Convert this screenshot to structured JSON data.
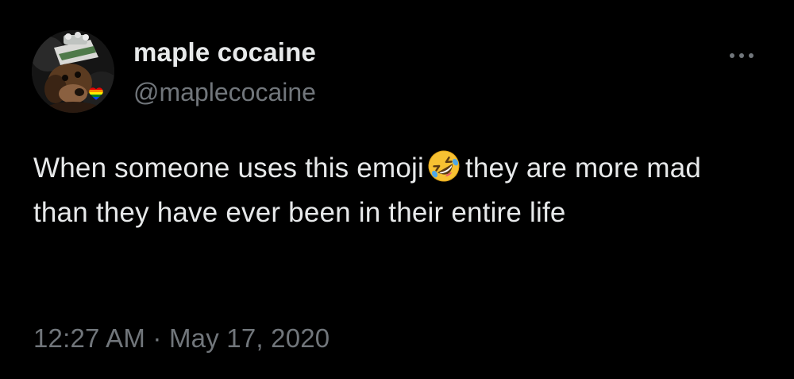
{
  "author": {
    "display_name": "maple cocaine",
    "handle": "@maplecocaine",
    "avatar": "avatar-dog-with-hat",
    "badge": "pride-heart-icon"
  },
  "menu": {
    "icon": "more-horizontal-icon"
  },
  "tweet": {
    "text_before_emoji": "When someone uses this emoji",
    "emoji": "rolling-on-floor-laughing-emoji",
    "text_after_emoji": "they are more mad than they have ever been in their entire life"
  },
  "meta": {
    "time": "12:27 AM",
    "separator": "·",
    "date": "May 17, 2020"
  },
  "colors": {
    "background": "#000000",
    "primary_text": "#e7e9ea",
    "secondary_text": "#71767b"
  }
}
